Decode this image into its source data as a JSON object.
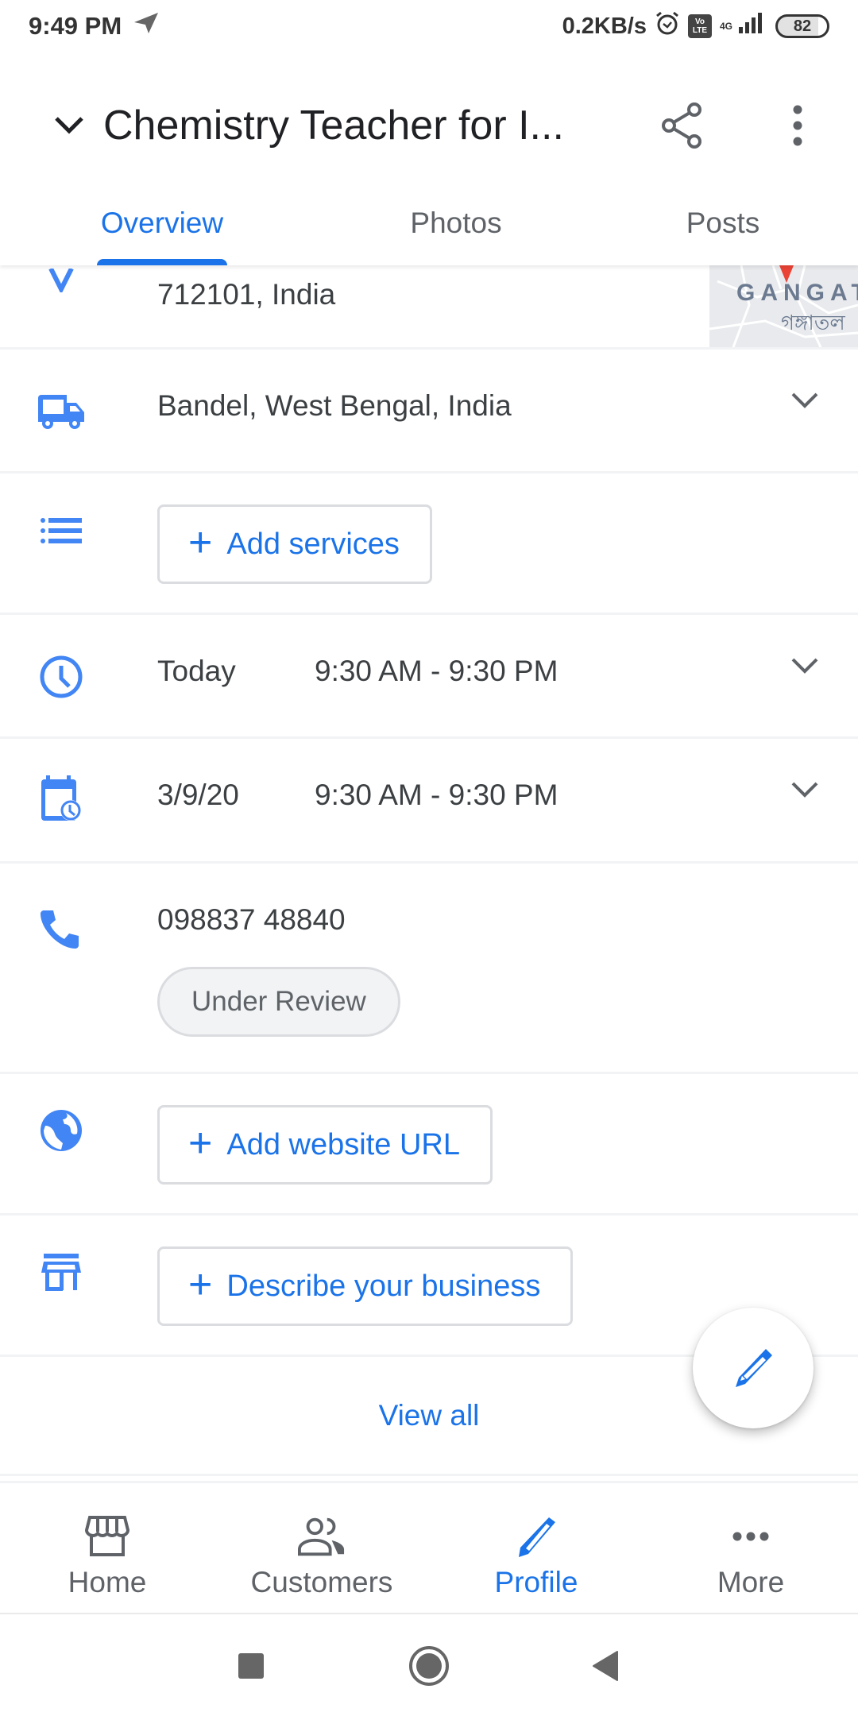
{
  "status_bar": {
    "time": "9:49 PM",
    "network_speed": "0.2KB/s",
    "network_type": "4G",
    "volte_top": "Vo",
    "volte_bottom": "LTE",
    "battery": "82",
    "icons": [
      "telegram-icon",
      "alarm-icon",
      "volte-icon",
      "signal-icon",
      "battery-icon"
    ]
  },
  "header": {
    "title": "Chemistry Teacher for I...",
    "collapse_icon": "chevron-down-icon",
    "share_icon": "share-icon",
    "more_icon": "more-vert-icon"
  },
  "tabs": [
    {
      "label": "Overview",
      "active": true
    },
    {
      "label": "Photos",
      "active": false
    },
    {
      "label": "Posts",
      "active": false
    }
  ],
  "rows": {
    "address": {
      "line2": "712101, India",
      "icon": "location-icon",
      "map_label": "GANGAT",
      "map_sub": "গঙ্গাতল"
    },
    "service_area": {
      "icon": "truck-icon",
      "text": "Bandel, West Bengal, India"
    },
    "services": {
      "icon": "list-icon",
      "button": "Add services"
    },
    "hours_today": {
      "icon": "clock-icon",
      "day": "Today",
      "hours": "9:30 AM - 9:30 PM"
    },
    "special_hours": {
      "icon": "calendar-clock-icon",
      "day": "3/9/20",
      "hours": "9:30 AM - 9:30 PM"
    },
    "phone": {
      "icon": "phone-icon",
      "number": "098837 48840",
      "status": "Under Review"
    },
    "website": {
      "icon": "globe-icon",
      "button": "Add website URL"
    },
    "description": {
      "icon": "store-icon",
      "button": "Describe your business"
    }
  },
  "view_all": "View all",
  "fab_icon": "edit-pencil-icon",
  "bottom_nav": [
    {
      "label": "Home",
      "icon": "storefront-icon",
      "active": false
    },
    {
      "label": "Customers",
      "icon": "people-icon",
      "active": false
    },
    {
      "label": "Profile",
      "icon": "pencil-icon",
      "active": true
    },
    {
      "label": "More",
      "icon": "more-horiz-icon",
      "active": false
    }
  ],
  "colors": {
    "accent": "#1a73e8",
    "icon_blue": "#4285f4",
    "text_primary": "#202124",
    "text_secondary": "#5f6368",
    "divider": "#f1f3f4",
    "map_pin": "#ea4335"
  }
}
